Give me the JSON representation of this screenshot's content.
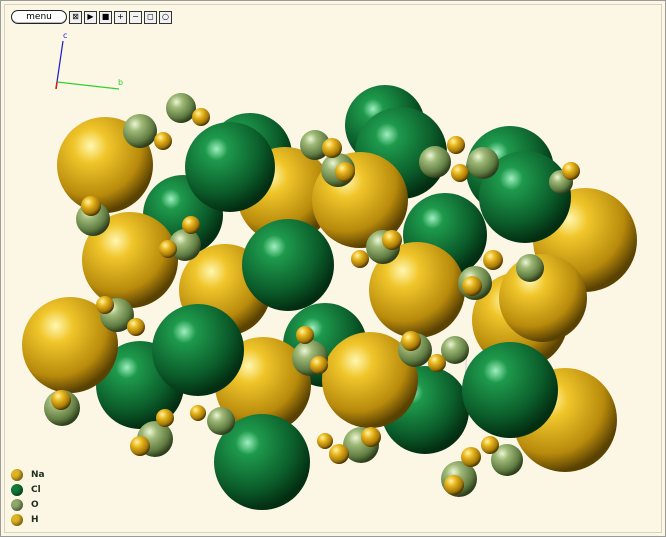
{
  "toolbar": {
    "menu_label": "menu",
    "buttons": [
      {
        "name": "close-view-button",
        "glyph": "⊠"
      },
      {
        "name": "play-button",
        "glyph": "▶"
      },
      {
        "name": "stop-button",
        "glyph": "■"
      },
      {
        "name": "zoom-in-button",
        "glyph": "+"
      },
      {
        "name": "zoom-out-button",
        "glyph": "−"
      },
      {
        "name": "frame-button",
        "glyph": "◻"
      },
      {
        "name": "reset-view-button",
        "glyph": "○"
      }
    ]
  },
  "axes": {
    "x_label": "",
    "y_label": "b",
    "z_label": "c",
    "x_color": "#d11a1a",
    "y_color": "#2fd12f",
    "z_color": "#1a1ad1"
  },
  "legend": [
    {
      "label": "Na",
      "color": "#e0b422"
    },
    {
      "label": "Cl",
      "color": "#137a3a"
    },
    {
      "label": "O",
      "color": "#8ea86a"
    },
    {
      "label": "H",
      "color": "#e0b422"
    }
  ],
  "colors": {
    "background": "#fbf7e4",
    "na_base": "#e0b422",
    "cl_base": "#137a3a",
    "o_base": "#8ea86a",
    "h_base": "#e0b422"
  }
}
